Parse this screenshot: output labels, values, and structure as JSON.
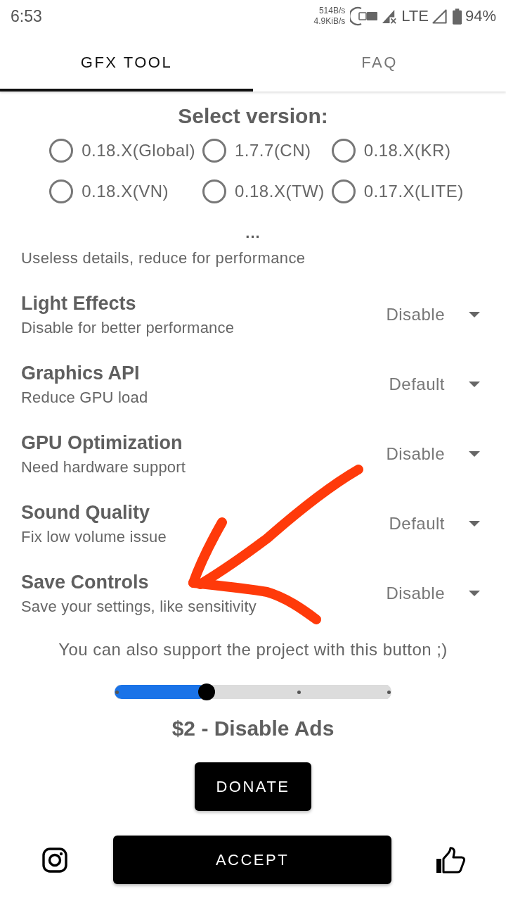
{
  "status_bar": {
    "time": "6:53",
    "upload_speed": "514B/s",
    "download_speed": "4.9KiB/s",
    "network": "LTE",
    "battery": "94%"
  },
  "tabs": [
    {
      "label": "GFX TOOL",
      "selected": true
    },
    {
      "label": "FAQ",
      "selected": false
    }
  ],
  "version_picker": {
    "title": "Select version:",
    "options": [
      {
        "label": "0.18.X(Global)",
        "selected": false
      },
      {
        "label": "1.7.7(CN)",
        "selected": false
      },
      {
        "label": "0.18.X(KR)",
        "selected": false
      },
      {
        "label": "0.18.X(VN)",
        "selected": false
      },
      {
        "label": "0.18.X(TW)",
        "selected": false
      },
      {
        "label": "0.17.X(LITE)",
        "selected": false
      }
    ]
  },
  "more_marker": "...",
  "section_note": "Useless details, reduce for performance",
  "settings": [
    {
      "title": "Light Effects",
      "description": "Disable for better performance",
      "value": "Disable"
    },
    {
      "title": "Graphics API",
      "description": "Reduce GPU load",
      "value": "Default"
    },
    {
      "title": "GPU Optimization",
      "description": "Need hardware support",
      "value": "Disable"
    },
    {
      "title": "Sound Quality",
      "description": "Fix low volume issue",
      "value": "Default"
    },
    {
      "title": "Save Controls",
      "description": "Save your settings, like sensitivity",
      "value": "Disable"
    }
  ],
  "annotations": [
    {
      "kind": "arrow"
    }
  ],
  "support": {
    "text": "You can also support the project with this button ;)",
    "slider": {
      "level": 0.333
    },
    "amount_label": "$2 - Disable Ads",
    "donate_button": "DONATE"
  },
  "footer": {
    "accept_button": "ACCEPT"
  }
}
